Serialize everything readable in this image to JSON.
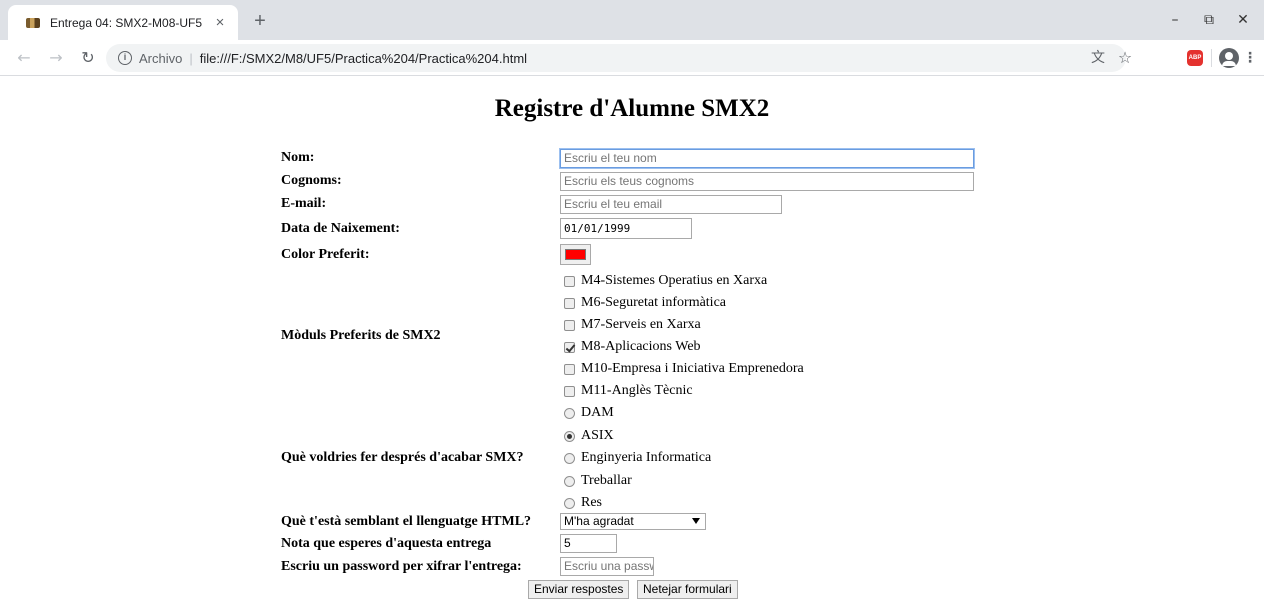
{
  "browser": {
    "tab_title": "Entrega 04: SMX2-M08-UF5",
    "tab_close": "×",
    "new_tab": "+",
    "address_scheme_label": "Archivo",
    "address_separator": "|",
    "url": "file:///F:/SMX2/M8/UF5/Practica%204/Practica%204.html",
    "icons": [
      "back-icon",
      "forward-icon",
      "reload-icon",
      "info-icon",
      "translate-icon",
      "star-icon",
      "adblock-icon",
      "account-icon",
      "menu-icon",
      "minimize-icon",
      "restore-icon",
      "close-icon"
    ],
    "abp_label": "ABP"
  },
  "page": {
    "title": "Registre d'Alumne SMX2",
    "fields": {
      "nom_label": "Nom:",
      "nom_placeholder": "Escriu el teu nom",
      "cognoms_label": "Cognoms:",
      "cognoms_placeholder": "Escriu els teus cognoms",
      "email_label": "E-mail:",
      "email_placeholder": "Escriu el teu email",
      "naixement_label": "Data de Naixement:",
      "naixement_value": "01/01/1999",
      "color_label": "Color Preferit:",
      "color_value": "#ff0000"
    },
    "moduls": {
      "label": "Mòduls Preferits de SMX2",
      "options": [
        {
          "label": "M4-Sistemes Operatius en Xarxa",
          "checked": false
        },
        {
          "label": "M6-Seguretat informàtica",
          "checked": false
        },
        {
          "label": "M7-Serveis en Xarxa",
          "checked": false
        },
        {
          "label": "M8-Aplicacions Web",
          "checked": true
        },
        {
          "label": "M10-Empresa i Iniciativa Emprenedora",
          "checked": false
        },
        {
          "label": "M11-Anglès Tècnic",
          "checked": false
        }
      ]
    },
    "futur": {
      "label": "Què voldries fer després d'acabar SMX?",
      "options": [
        {
          "label": "DAM",
          "selected": false
        },
        {
          "label": "ASIX",
          "selected": true
        },
        {
          "label": "Enginyeria Informatica",
          "selected": false
        },
        {
          "label": "Treballar",
          "selected": false
        },
        {
          "label": "Res",
          "selected": false
        }
      ]
    },
    "html_opinio": {
      "label": "Què t'està semblant el llenguatge HTML?",
      "selected": "M'ha agradat"
    },
    "nota": {
      "label": "Nota que esperes d'aquesta entrega",
      "value": "5"
    },
    "password": {
      "label": "Escriu un password per xifrar l'entrega:",
      "placeholder": "Escriu una passw"
    },
    "buttons": {
      "submit": "Enviar respostes",
      "reset": "Netejar formulari"
    }
  }
}
